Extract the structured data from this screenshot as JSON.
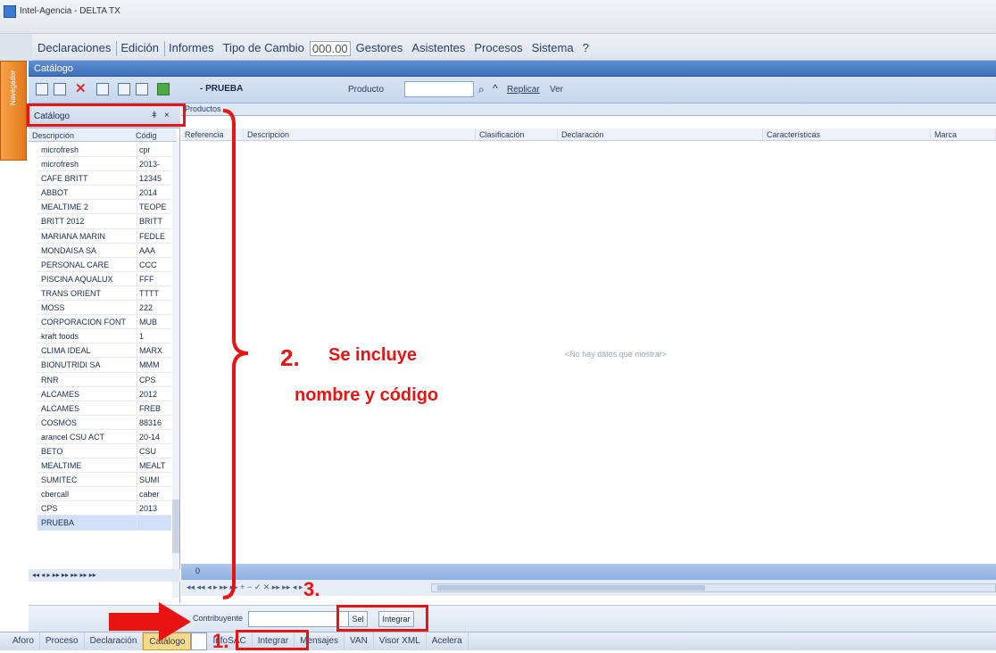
{
  "window": {
    "title": "Intel-Agencia - DELTA TX"
  },
  "menu": {
    "items": [
      "Declaraciones",
      "Edición",
      "Informes",
      "Tipo de Cambio",
      "000.00",
      "Gestores",
      "Asistentes",
      "Procesos",
      "Sistema",
      "?"
    ]
  },
  "left_tab": {
    "label": "Navegador"
  },
  "catalog_window": {
    "title": "Catálogo"
  },
  "toolbar": {
    "active_item": "- PRUEBA",
    "producto_label": "Producto",
    "producto_value": "",
    "replicar_label": "Replicar",
    "ver_label": "Ver"
  },
  "left_panel": {
    "title": "Catálogo",
    "columns": [
      "Descripción",
      "Códig"
    ],
    "rows": [
      {
        "desc": "microfresh",
        "code": "cpr"
      },
      {
        "desc": "microfresh",
        "code": "2013-"
      },
      {
        "desc": "CAFE BRITT",
        "code": "12345"
      },
      {
        "desc": "ABBOT",
        "code": "2014"
      },
      {
        "desc": "MEALTIME 2",
        "code": "TEOPE"
      },
      {
        "desc": "BRITT 2012",
        "code": "BRITT"
      },
      {
        "desc": "MARIANA MARIN",
        "code": "FEDLE"
      },
      {
        "desc": "MONDAISA SA",
        "code": "AAA"
      },
      {
        "desc": "PERSONAL CARE",
        "code": "CCC"
      },
      {
        "desc": "PISCINA AQUALUX",
        "code": "FFF"
      },
      {
        "desc": "TRANS ORIENT",
        "code": "TTTT"
      },
      {
        "desc": "MOSS",
        "code": "222"
      },
      {
        "desc": "CORPORACION FONT",
        "code": "MUB"
      },
      {
        "desc": "kraft foods",
        "code": "1"
      },
      {
        "desc": "CLIMA IDEAL",
        "code": "MARX"
      },
      {
        "desc": "BIONUTRIDI SA",
        "code": "MMM"
      },
      {
        "desc": "RNR",
        "code": "CPS"
      },
      {
        "desc": "ALCAMES",
        "code": "2012"
      },
      {
        "desc": "ALCAMES",
        "code": "FREB"
      },
      {
        "desc": "COSMOS",
        "code": "88316"
      },
      {
        "desc": "arancel CSU ACT",
        "code": "20-14"
      },
      {
        "desc": "BETO",
        "code": "CSU"
      },
      {
        "desc": "MEALTIME",
        "code": "MEALT"
      },
      {
        "desc": "SUMITEC",
        "code": "SUMI"
      },
      {
        "desc": "cbercall",
        "code": "caber"
      },
      {
        "desc": "CPS",
        "code": "2013"
      },
      {
        "desc": "PRUEBA",
        "code": ""
      }
    ],
    "nav": "◂◂ ◂ ▸ ▸▸ ▸▸ ▸▸ ▸▸ ▸▸"
  },
  "main_grid": {
    "tab": "Productos",
    "columns": [
      "Referencia",
      "Descripción",
      "Clasificación",
      "Declaración",
      "Características",
      "Marca"
    ],
    "empty_text": "<No hay datos que mostrar>",
    "count": "0",
    "nav": "◂◂ ◂◂ ◂ ▸ ▸▸ ▸▸ + − ✓ ✕ ▸▸ ▸▸ ◂ ▸"
  },
  "bottom": {
    "contribuyente_label": "Contribuyente",
    "contribuyente_value": "",
    "sel_button": "Sel",
    "integrar_button": "Integrar"
  },
  "taskbar": {
    "items": [
      "Aforo",
      "Proceso",
      "Declaración",
      "Catálogo",
      "",
      "InfoSAC",
      "Integrar",
      "Mensajes",
      "VAN",
      "Visor XML",
      "Acelera"
    ]
  },
  "annotations": {
    "n1": "1.",
    "n2": "2.",
    "n3": "3.",
    "text_line1": "Se incluye",
    "text_line2": "nombre y código"
  },
  "colors": {
    "annotation_red": "#e81414",
    "title_blue": "#4a7fc8",
    "tab_orange": "#f08a2a"
  }
}
